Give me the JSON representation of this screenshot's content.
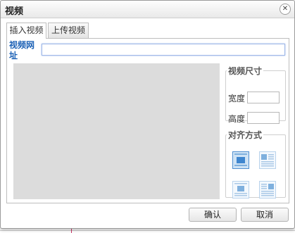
{
  "dialog": {
    "title": "视频",
    "close_glyph": "✕"
  },
  "tabs": [
    {
      "label": "插入视频",
      "active": true
    },
    {
      "label": "上传视频",
      "active": false
    }
  ],
  "url": {
    "label": "视频网址",
    "value": "",
    "placeholder": ""
  },
  "size": {
    "legend": "视频尺寸",
    "width_label": "宽度",
    "height_label": "高度",
    "width_value": "",
    "height_value": ""
  },
  "alignment": {
    "legend": "对齐方式",
    "options": [
      {
        "icon": "align-none-icon",
        "selected": true
      },
      {
        "icon": "align-left-icon",
        "selected": false
      },
      {
        "icon": "align-center-icon",
        "selected": false
      },
      {
        "icon": "align-right-icon",
        "selected": false
      }
    ]
  },
  "buttons": {
    "ok": "确认",
    "cancel": "取消"
  },
  "colors": {
    "accent": "#1d62b6",
    "preview_bg": "#dcdcdc",
    "input_focus": "#9fb8e8"
  }
}
